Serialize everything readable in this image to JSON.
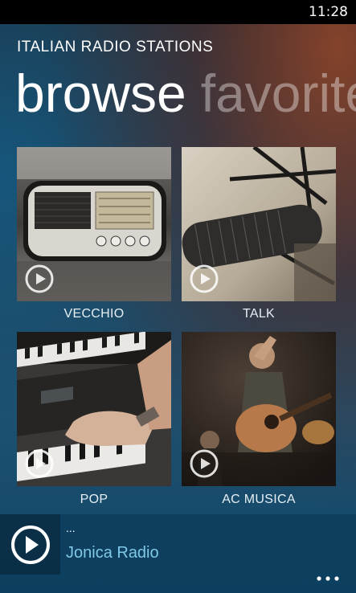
{
  "status_bar": {
    "time": "11:28"
  },
  "app": {
    "title": "ITALIAN RADIO STATIONS"
  },
  "pivot": {
    "items": [
      {
        "label": "browse",
        "active": true
      },
      {
        "label": "favorites",
        "active": false
      }
    ]
  },
  "tiles": [
    {
      "label": "VECCHIO",
      "image": "vintage-radio"
    },
    {
      "label": "TALK",
      "image": "studio-microphone"
    },
    {
      "label": "POP",
      "image": "keyboard-piano"
    },
    {
      "label": "AC MUSICA",
      "image": "guitar-performer"
    }
  ],
  "now_playing": {
    "status": "...",
    "station": "Jonica Radio"
  },
  "icons": {
    "play": "play-circle-icon",
    "more": "more-dots-icon"
  },
  "colors": {
    "accent": "#7fc8e8",
    "text": "#ffffff"
  }
}
